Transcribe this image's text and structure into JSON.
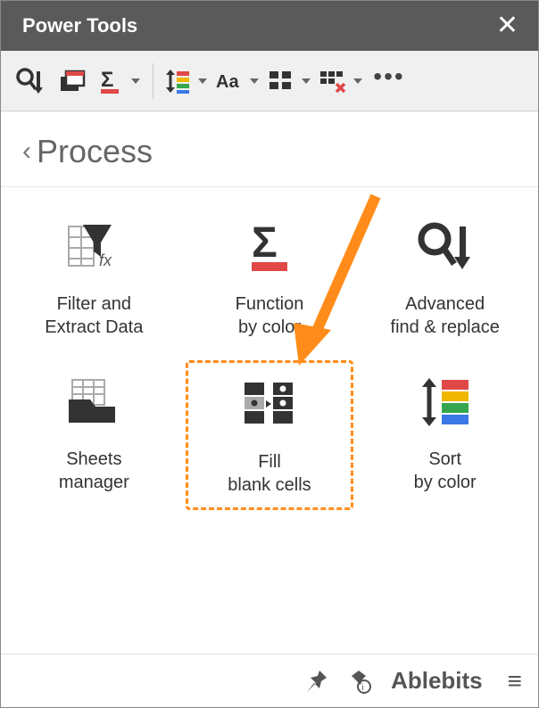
{
  "header": {
    "title": "Power Tools"
  },
  "toolbar": {
    "items": [
      {
        "name": "find-replace-icon"
      },
      {
        "name": "compare-sheets-icon"
      },
      {
        "name": "sum-by-color-icon",
        "dropdown": true
      },
      {
        "name": "sort-icon",
        "dropdown": true
      },
      {
        "name": "text-case-icon",
        "dropdown": true
      },
      {
        "name": "split-icon",
        "dropdown": true
      },
      {
        "name": "remove-icon",
        "dropdown": true
      },
      {
        "name": "more-icon"
      }
    ]
  },
  "breadcrumb": {
    "label": "Process"
  },
  "tiles": [
    {
      "id": "filter-extract",
      "label": "Filter and\nExtract Data"
    },
    {
      "id": "function-by-color",
      "label": "Function\nby color"
    },
    {
      "id": "advanced-find-replace",
      "label": "Advanced\nfind & replace"
    },
    {
      "id": "sheets-manager",
      "label": "Sheets\nmanager"
    },
    {
      "id": "fill-blank-cells",
      "label": "Fill\nblank cells",
      "highlighted": true
    },
    {
      "id": "sort-by-color",
      "label": "Sort\nby color"
    }
  ],
  "footer": {
    "brand": "Ablebits"
  }
}
